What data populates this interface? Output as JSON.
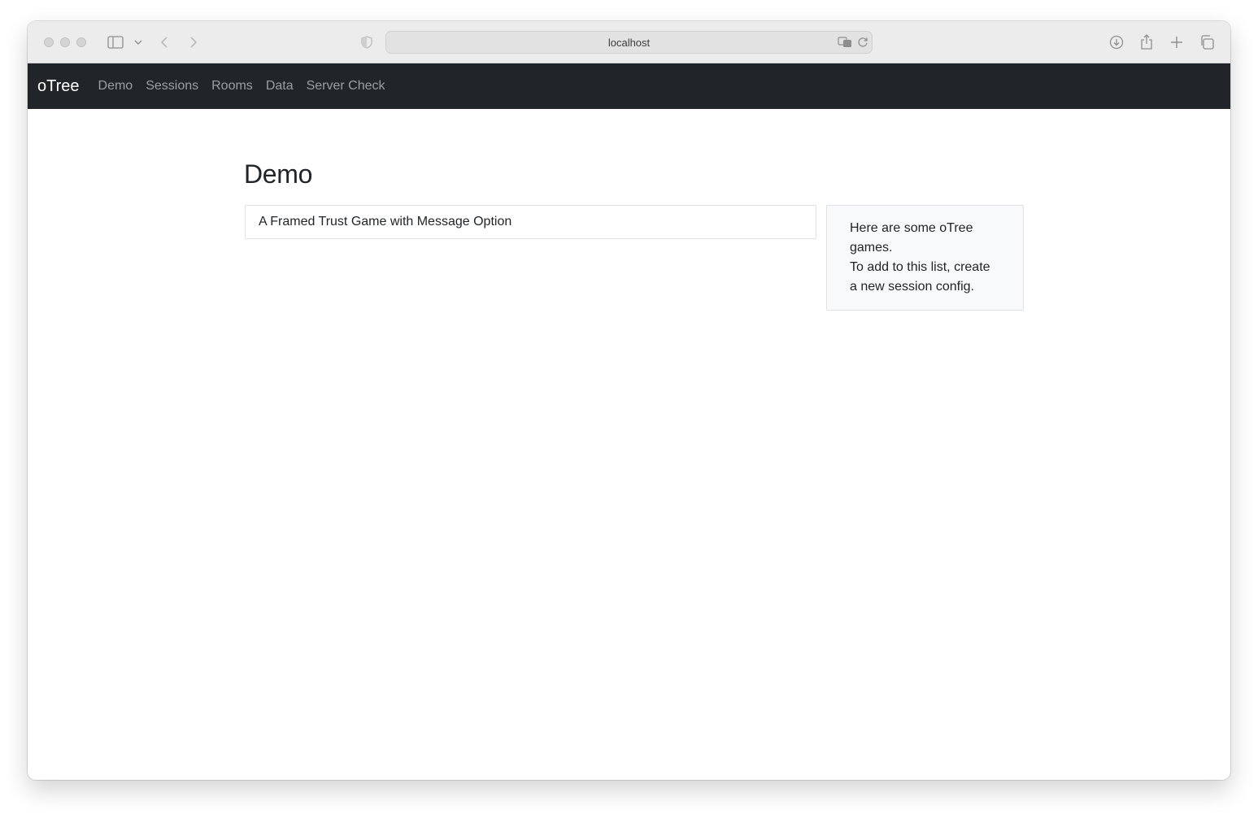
{
  "browser": {
    "url": "localhost"
  },
  "navbar": {
    "brand": "oTree",
    "links": [
      "Demo",
      "Sessions",
      "Rooms",
      "Data",
      "Server Check"
    ]
  },
  "main": {
    "title": "Demo",
    "games": [
      "A Framed Trust Game with Message Option"
    ],
    "info": {
      "line1": "Here are some oTree games.",
      "line2": "To add to this list, create a new session config."
    }
  }
}
